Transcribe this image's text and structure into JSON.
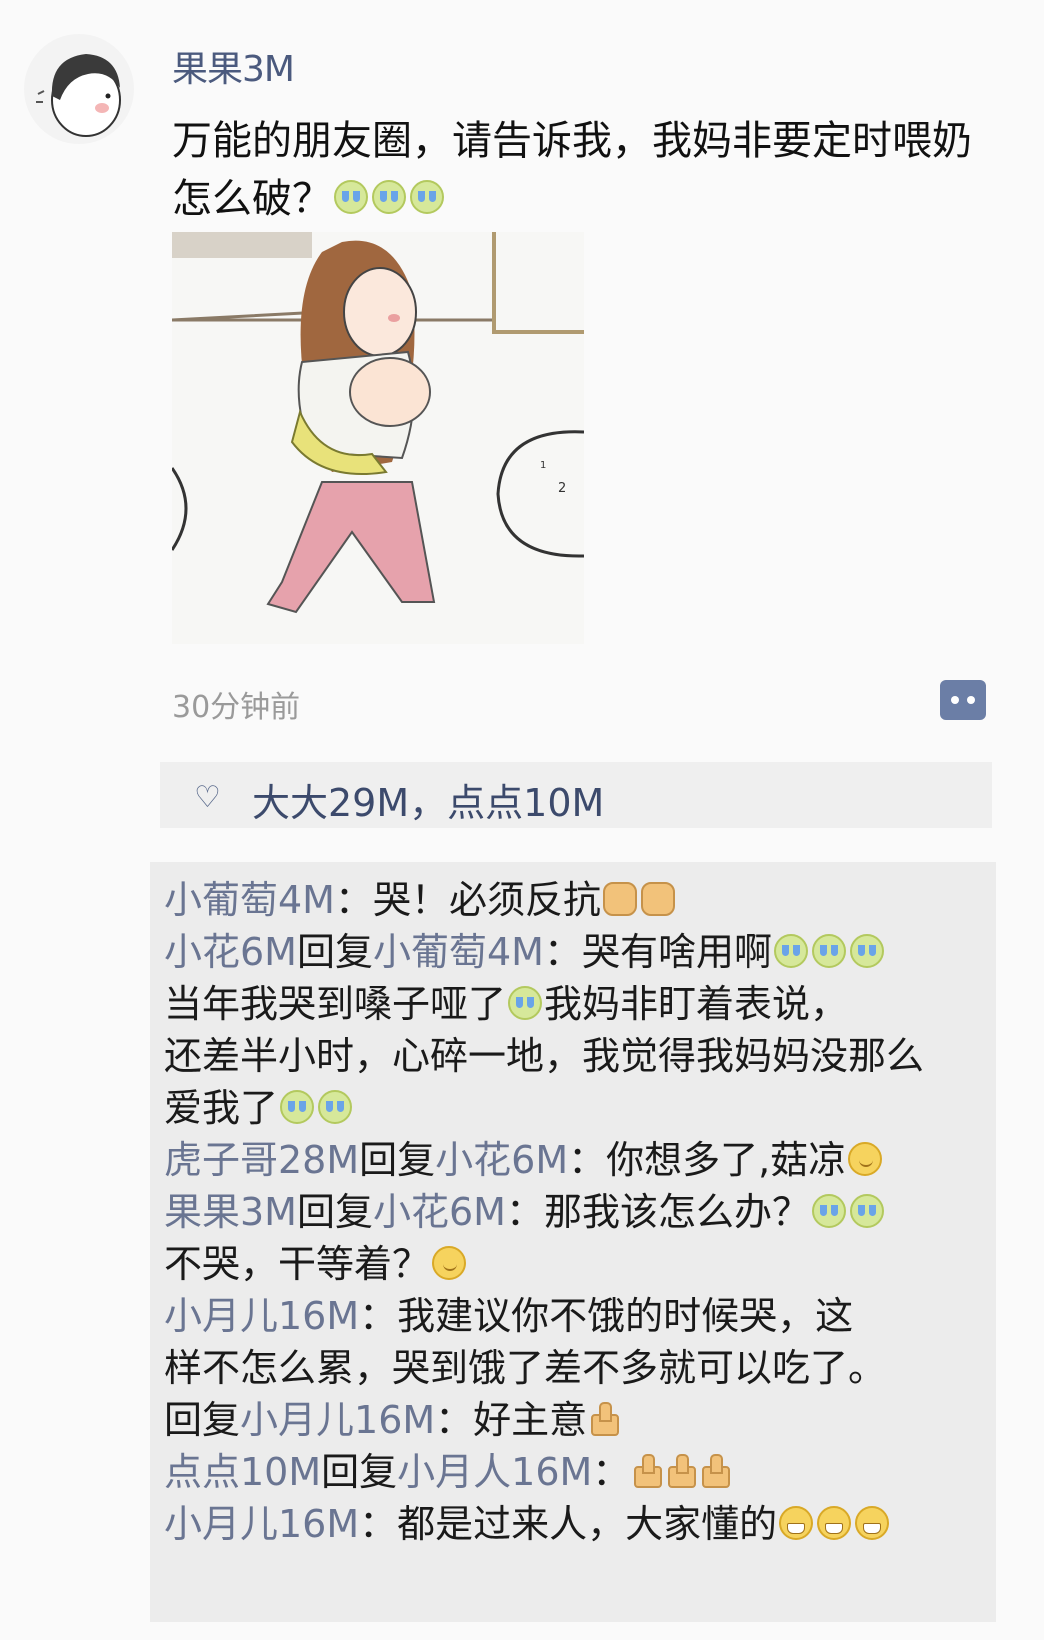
{
  "post": {
    "author": "果果3M",
    "text_line1": "万能的朋友圈，请告诉我，我妈非要定时喂奶",
    "text_line2": "怎么破？",
    "time": "30分钟前",
    "text_emoji": [
      "crying-face",
      "crying-face",
      "crying-face"
    ]
  },
  "likes": {
    "names": "大大29M，点点10M"
  },
  "comments": [
    {
      "name": "小葡萄4M",
      "text": "：哭！必须反抗",
      "emoji": [
        "fist",
        "fist"
      ]
    },
    {
      "name": "小花6M",
      "reply_label": "回复",
      "reply_to": "小葡萄4M",
      "text": "：哭有啥用啊",
      "emoji": [
        "crying-face",
        "crying-face",
        "crying-face"
      ]
    },
    {
      "text": "当年我哭到嗓子哑了",
      "emoji": [
        "crying-face"
      ],
      "text_after_emoji": "我妈非盯着表说，"
    },
    {
      "text": "还差半小时，心碎一地，我觉得我妈妈没那么"
    },
    {
      "text": "爱我了",
      "emoji": [
        "crying-face",
        "crying-face"
      ]
    },
    {
      "name": "虎子哥28M",
      "reply_label": "回复",
      "reply_to": "小花6M",
      "text": "：你想多了,菇凉",
      "emoji": [
        "smirk-face"
      ]
    },
    {
      "name": "果果3M",
      "reply_label": "回复",
      "reply_to": "小花6M",
      "text": "：那我该怎么办？",
      "emoji": [
        "crying-face",
        "crying-face"
      ]
    },
    {
      "text": "不哭，干等着？",
      "emoji": [
        "smirk-face"
      ]
    },
    {
      "name": "小月儿16M",
      "text": "：我建议你不饿的时候哭，这"
    },
    {
      "text": "样不怎么累，哭到饿了差不多就可以吃了。"
    },
    {
      "reply_label": "回复",
      "reply_to": "小月儿16M",
      "text": "：好主意",
      "emoji": [
        "thumbs-up"
      ]
    },
    {
      "name": "点点10M",
      "reply_label": "回复",
      "reply_to": "小月人16M",
      "text": "：",
      "emoji": [
        "thumbs-up",
        "thumbs-up",
        "thumbs-up"
      ]
    },
    {
      "name": "小月儿16M",
      "text": "：都是过来人，大家懂的",
      "emoji": [
        "grin-face",
        "grin-face",
        "grin-face"
      ]
    }
  ]
}
